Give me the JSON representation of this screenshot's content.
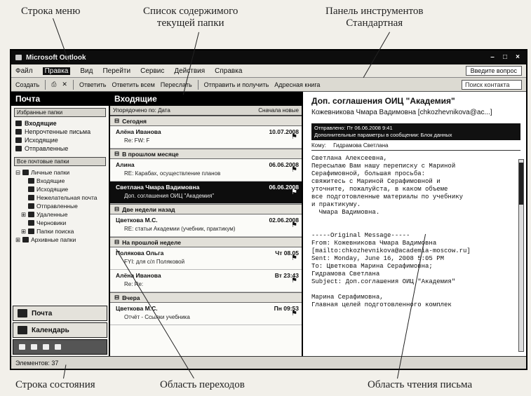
{
  "callouts": {
    "menu_bar": "Строка меню",
    "folder_list": "Список содержимого\nтекущей папки",
    "toolbar": "Панель инструментов\nСтандартная",
    "status_bar": "Строка состояния",
    "nav_pane": "Область переходов",
    "reading_pane": "Область чтения письма"
  },
  "window": {
    "title": "Microsoft Outlook",
    "controls": [
      "–",
      "□",
      "×"
    ]
  },
  "menu": {
    "items": [
      "Файл",
      "Правка",
      "Вид",
      "Перейти",
      "Сервис",
      "Действия",
      "Справка"
    ],
    "help_box": "Введите вопрос"
  },
  "toolbar": {
    "items": [
      "Создать",
      "Ответить",
      "Ответить всем",
      "Переслать",
      "Отправить и получить",
      "Адресная книга"
    ],
    "search": "Поиск контакта"
  },
  "nav": {
    "title": "Почта",
    "favorites_header": "Избранные папки",
    "favorites": [
      "Входящие",
      "Непрочтенные письма",
      "Исходящие",
      "Отправленные"
    ],
    "all_folders_header": "Все почтовые папки",
    "tree": [
      "Личные папки",
      "Входящие",
      "Исходящие",
      "Нежелательная почта",
      "Отправленные",
      "Удаленные",
      "Черновики",
      "Папки поиска",
      "Архивные папки"
    ],
    "buttons": [
      "Почта",
      "Календарь"
    ]
  },
  "list": {
    "title": "Входящие",
    "arrange_left": "Упорядочено по: Дата",
    "arrange_right": "Сначала новые",
    "groups": [
      {
        "label": "Сегодня",
        "messages": [
          {
            "sender": "Алёна Иванова",
            "date": "10.07.2008",
            "subject": "Re: FW: F",
            "selected": false
          }
        ]
      },
      {
        "label": "В прошлом месяце",
        "messages": [
          {
            "sender": "Алина",
            "date": "06.06.2008",
            "subject": "RE: Карабах, осуществление планов",
            "selected": false
          },
          {
            "sender": "Светлана Чмара Вадимовна",
            "date": "06.06.2008",
            "subject": "Доп. соглашения ОИЦ \"Академия\"",
            "selected": true
          }
        ]
      },
      {
        "label": "Две недели назад",
        "messages": [
          {
            "sender": "Цветкова М.С.",
            "date": "02.06.2008",
            "subject": "RE: статьи Академии (учебник, практикум)",
            "selected": false
          }
        ]
      },
      {
        "label": "На прошлой неделе",
        "messages": [
          {
            "sender": "Полякова Ольга",
            "date": "Чт 08.05",
            "subject": "FYI: для с/л Поляковой",
            "selected": false
          },
          {
            "sender": "Алёна Иванова",
            "date": "Вт 23:43",
            "subject": "Re: Re:",
            "selected": false
          }
        ]
      },
      {
        "label": "Вчера",
        "messages": [
          {
            "sender": "Цветкова М.С.",
            "date": "Пн 09:53",
            "subject": "Отчёт - Ссылки учебника",
            "selected": false
          }
        ]
      }
    ]
  },
  "reading": {
    "subject": "Доп. соглашения ОИЦ \"Академия\"",
    "from": "Кожевникова Чмара Вадимовна [chkozhevnikova@ac...]",
    "info_line1": "Отправлено: Пт 06.06.2008 9:41",
    "info_line2": "Дополнительные параметры в сообщении: Блок данных",
    "to_label": "Кому:",
    "to_value": "Гидрамова Светлана",
    "body": "Светлана Алексеевна,\nПересылаю Вам нашу переписку с Мариной\nСерафимовной, большая просьба:\nсвяжитесь с Мариной Серафимовной и\nуточните, пожалуйста, в каком объеме\nвсе подготовленные материалы по учебнику\nи практикуму.\n  Чмара Вадимовна.\n\n\n-----Original Message-----\nFrom: Кожевникова Чмара Вадимовна\n[mailto:chkozhevnikova@academia-moscow.ru]\nSent: Monday, June 16, 2008 5:05 PM\nTo: Цветкова Марина Серафимовна;\nГидрамова Светлана\nSubject: Доп.соглашения ОИЦ \"Академия\"\n\nМарина Серафимовна,\nГлавная целей подготовленного комплек"
  },
  "status": {
    "items": [
      "Элементов: 37"
    ]
  }
}
